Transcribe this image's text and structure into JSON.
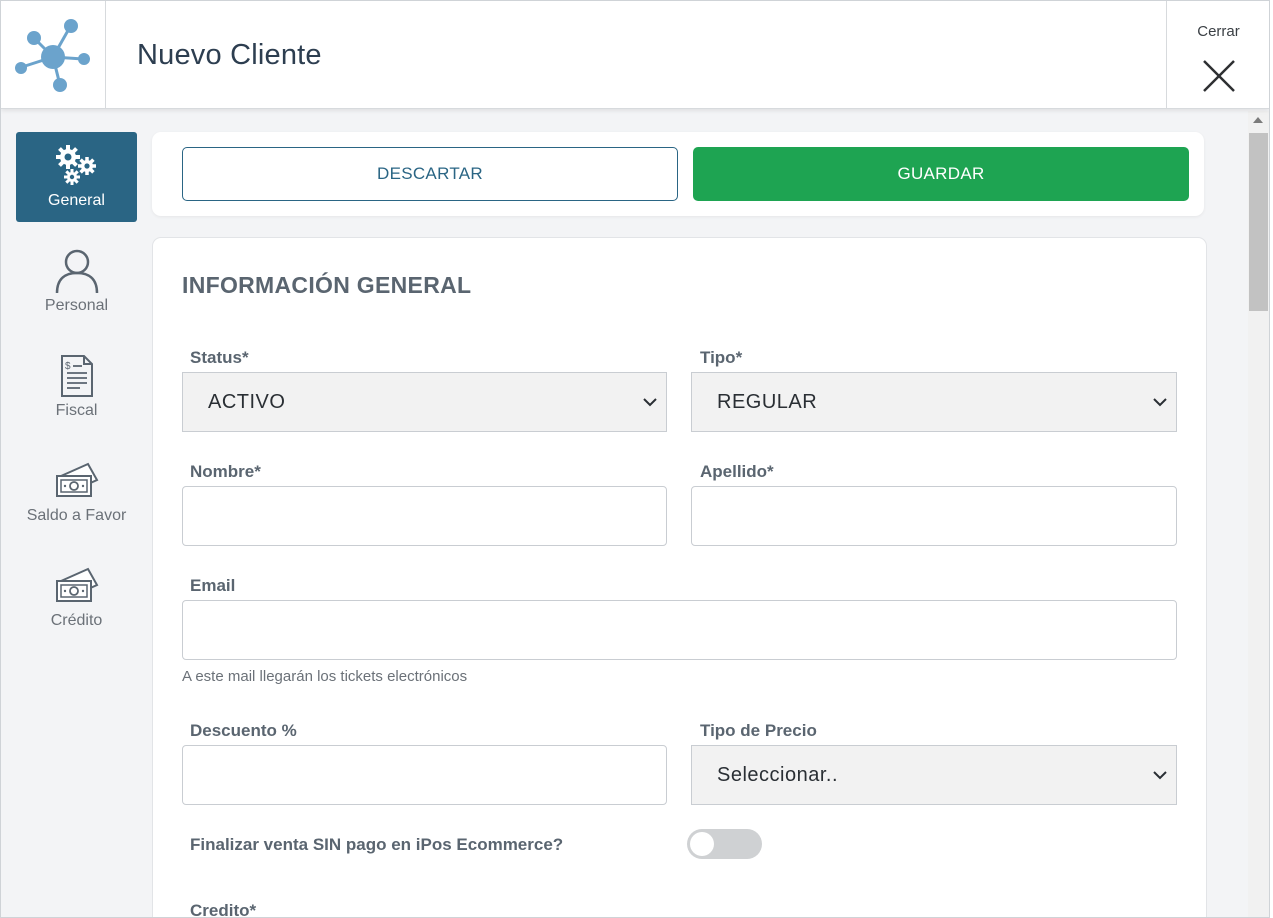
{
  "header": {
    "title": "Nuevo Cliente",
    "close_label": "Cerrar",
    "logo_icon": "network-logo-icon",
    "close_icon": "close-icon"
  },
  "sidebar": {
    "items": [
      {
        "label": "General",
        "icon": "gears-icon",
        "active": true
      },
      {
        "label": "Personal",
        "icon": "person-icon",
        "active": false
      },
      {
        "label": "Fiscal",
        "icon": "document-icon",
        "active": false
      },
      {
        "label": "Saldo a Favor",
        "icon": "money-icon",
        "active": false
      },
      {
        "label": "Crédito",
        "icon": "money-icon",
        "active": false
      }
    ]
  },
  "actions": {
    "discard_label": "DESCARTAR",
    "save_label": "GUARDAR"
  },
  "form": {
    "section_title": "INFORMACIÓN GENERAL",
    "status": {
      "label": "Status*",
      "value": "ACTIVO"
    },
    "tipo": {
      "label": "Tipo*",
      "value": "REGULAR"
    },
    "nombre": {
      "label": "Nombre*",
      "value": ""
    },
    "apellido": {
      "label": "Apellido*",
      "value": ""
    },
    "email": {
      "label": "Email",
      "value": "",
      "hint": "A este mail llegarán los tickets electrónicos"
    },
    "descuento": {
      "label": "Descuento %",
      "value": ""
    },
    "tipo_precio": {
      "label": "Tipo de Precio",
      "value": "Seleccionar.."
    },
    "finalizar_venta": {
      "label": "Finalizar venta SIN pago en iPos Ecommerce?",
      "enabled": false
    },
    "credito": {
      "label": "Credito*"
    }
  },
  "colors": {
    "primary": "#2a6584",
    "save_green": "#1ea452",
    "label_gray": "#5a6570",
    "logo_blue": "#6ba3cc"
  }
}
